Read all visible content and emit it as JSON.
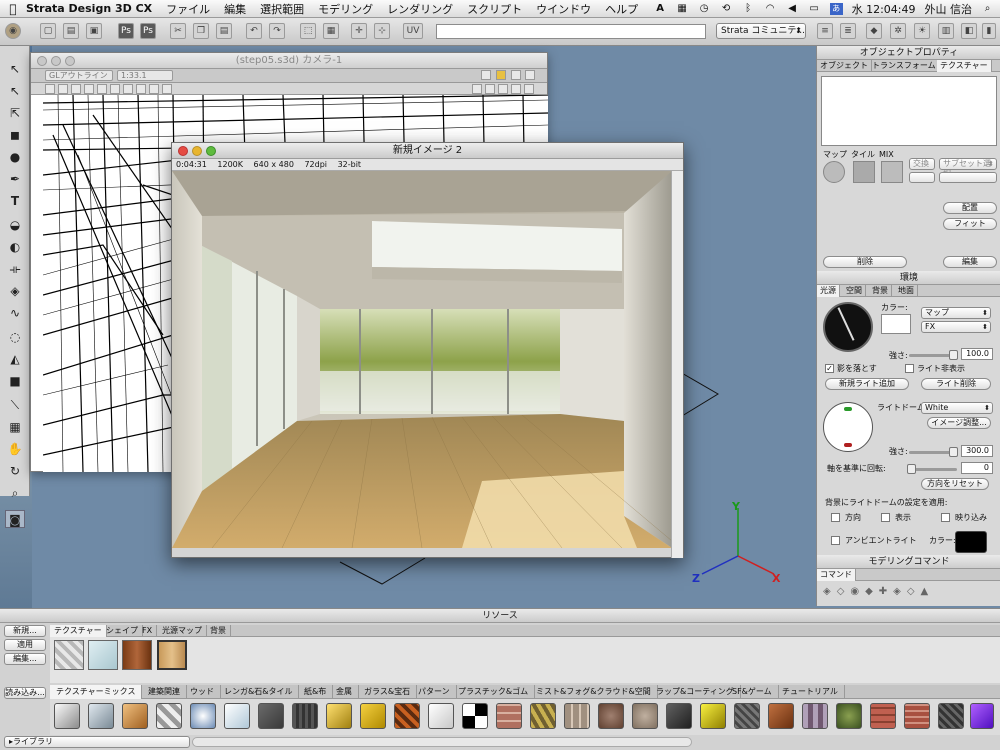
{
  "menubar": {
    "app_name": "Strata Design 3D CX",
    "items": [
      "ファイル",
      "編集",
      "選択範囲",
      "モデリング",
      "レンダリング",
      "スクリプト",
      "ウインドウ",
      "ヘルプ"
    ],
    "clock": "水 12:04:49",
    "user": "外山 信治"
  },
  "toolbar": {
    "community_select": "Strata コミュニテ...",
    "icon_labels": [
      "Ps",
      "Ps",
      "UV"
    ]
  },
  "camera_window": {
    "title": "(step05.s3d) カメラ-1",
    "render_mode": "GLアウトライン",
    "zoom": "1:33.1"
  },
  "render_window": {
    "title": "新規イメージ 2",
    "time": "0:04:31",
    "size": "1200K",
    "resolution": "640 x 480",
    "dpi": "72dpi",
    "depth": "32-bit"
  },
  "object_props": {
    "title": "オブジェクトプロパティ",
    "tabs": [
      "オブジェクト",
      "トランスフォーム",
      "テクスチャー"
    ],
    "map_labels": [
      "マップ",
      "タイル",
      "MIX"
    ],
    "swap_label": "交換",
    "subset_select": "サブセット選択",
    "place_button": "配置",
    "fit_button": "フィット",
    "delete_button": "削除",
    "edit_button": "編集"
  },
  "environment": {
    "title": "環境",
    "tabs": [
      "光源",
      "空間",
      "背景",
      "地面"
    ],
    "color_label": "カラー:",
    "map_select": "マップ",
    "fx_select": "FX",
    "intensity_label": "強さ:",
    "intensity_value": "100.0",
    "cast_shadow_label": "影を落とす",
    "light_hide_label": "ライト非表示",
    "add_light_button": "新規ライト追加",
    "delete_light_button": "ライト削除",
    "light_dome_label": "ライトドーム:",
    "light_dome_select": "White",
    "image_adjust_button": "イメージ調整...",
    "intensity2_value": "300.0",
    "rotate_label": "軸を基準に回転:",
    "rotate_value": "0",
    "reset_direction_button": "方向をリセット",
    "apply_label": "背景にライトドームの設定を適用:",
    "apply_options": [
      "方向",
      "表示",
      "映り込み"
    ],
    "ambient_label": "アンビエントライト",
    "ambient_color_label": "カラー:"
  },
  "modeling": {
    "title": "モデリングコマンド",
    "tab": "コマンド"
  },
  "resources": {
    "title": "リソース",
    "buttons": [
      "新規...",
      "適用",
      "編集...",
      "読み込み..."
    ],
    "tabs": [
      "テクスチャー",
      "シェイプ",
      "FX",
      "光源マップ",
      "背景"
    ],
    "library_tabs": [
      "テクスチャーミックス",
      "建築関連",
      "ウッド",
      "レンガ&石&タイル",
      "紙&布",
      "金属",
      "ガラス&宝石",
      "パターン",
      "プラスチック&ゴム",
      "ミスト&フォグ&クラウド&空間",
      "ラップ&コーティング",
      "SF&ゲーム",
      "チュートリアル"
    ],
    "library_button": "ライブラリ"
  },
  "axis_labels": {
    "x": "X",
    "y": "Y",
    "z": "Z"
  }
}
